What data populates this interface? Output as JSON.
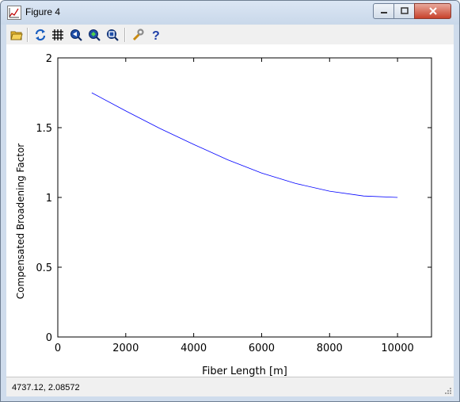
{
  "window": {
    "title": "Figure 4",
    "buttons": {
      "minimize": "minimize",
      "maximize": "maximize",
      "close": "close"
    }
  },
  "toolbar": {
    "items": [
      {
        "icon": "open-folder-icon",
        "name": "open"
      },
      {
        "icon": "refresh-icon",
        "name": "refresh"
      },
      {
        "icon": "grid-icon",
        "name": "grid"
      },
      {
        "icon": "zoom-in-icon",
        "name": "zoom-in"
      },
      {
        "icon": "zoom-out-icon",
        "name": "zoom-out"
      },
      {
        "icon": "zoom-fit-icon",
        "name": "zoom-fit"
      },
      {
        "icon": "wrench-icon",
        "name": "settings"
      },
      {
        "icon": "help-icon",
        "name": "help"
      }
    ]
  },
  "status": {
    "coords": "4737.12,  2.08572"
  },
  "colors": {
    "line": "#0000ff",
    "frame": "#000000"
  },
  "chart_data": {
    "type": "line",
    "title": "",
    "xlabel": "Fiber Length [m]",
    "ylabel": "Compensated Broadening Factor",
    "xlim": [
      0,
      11000
    ],
    "ylim": [
      0,
      2
    ],
    "xticks": [
      0,
      2000,
      4000,
      6000,
      8000,
      10000
    ],
    "yticks": [
      0,
      0.5,
      1,
      1.5,
      2
    ],
    "ytick_labels": [
      "0",
      "0.5",
      "1",
      "1.5",
      "2"
    ],
    "grid": false,
    "series": [
      {
        "x": [
          1000,
          2000,
          3000,
          4000,
          5000,
          6000,
          7000,
          8000,
          9000,
          10000
        ],
        "y": [
          1.75,
          1.62,
          1.495,
          1.38,
          1.27,
          1.175,
          1.1,
          1.045,
          1.01,
          1.0
        ]
      }
    ]
  }
}
